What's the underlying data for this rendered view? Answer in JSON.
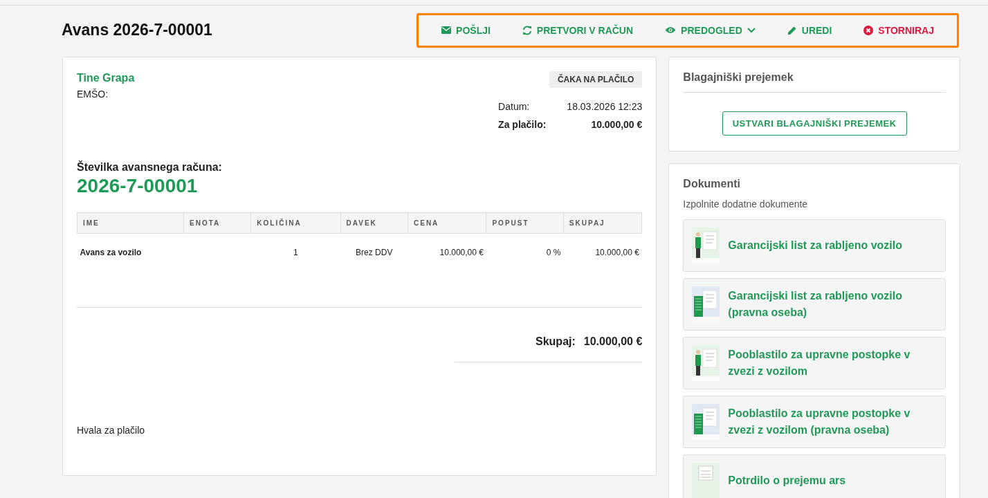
{
  "title": "Avans 2026-7-00001",
  "actions": [
    {
      "label": "POŠLJI",
      "kind": "send",
      "dropdown": false
    },
    {
      "label": "PRETVORI V RAČUN",
      "kind": "convert",
      "dropdown": false
    },
    {
      "label": "PREDOGLED",
      "kind": "preview",
      "dropdown": true
    },
    {
      "label": "UREDI",
      "kind": "edit",
      "dropdown": false
    },
    {
      "label": "STORNIRAJ",
      "kind": "cancel",
      "dropdown": false
    }
  ],
  "invoice": {
    "customer": "Tine Grapa",
    "emso_label": "EMŠO:",
    "status": "ČAKA NA PLAČILO",
    "date_label": "Datum:",
    "date": "18.03.2026 12:23",
    "due_label": "Za plačilo:",
    "due": "10.000,00 €",
    "number_label": "Številka avansnega računa:",
    "number": "2026-7-00001",
    "table": {
      "columns": [
        "IME",
        "ENOTA",
        "KOLIČINA",
        "DAVEK",
        "CENA",
        "POPUST",
        "SKUPAJ"
      ],
      "rows": [
        [
          "Avans za vozilo",
          "",
          "1",
          "Brez DDV",
          "10.000,00 €",
          "0 %",
          "10.000,00 €"
        ]
      ]
    },
    "total_label": "Skupaj:",
    "total": "10.000,00 €",
    "footer": "Hvala za plačilo"
  },
  "receipt": {
    "title": "Blagajniški prejemek",
    "button": "USTVARI BLAGAJNIŠKI PREJEMEK"
  },
  "documents": {
    "title": "Dokumenti",
    "subtitle": "Izpolnite dodatne dokumente",
    "items": [
      {
        "label": "Garancijski list za rabljeno vozilo",
        "kind": "person"
      },
      {
        "label": "Garancijski list za rabljeno vozilo (pravna oseba)",
        "kind": "building"
      },
      {
        "label": "Pooblastilo za upravne postopke v zvezi z vozilom",
        "kind": "person"
      },
      {
        "label": "Pooblastilo za upravne postopke v zvezi z vozilom (pravna oseba)",
        "kind": "building"
      },
      {
        "label": "Potrdilo o prejemu ars",
        "kind": "calendar"
      }
    ]
  }
}
